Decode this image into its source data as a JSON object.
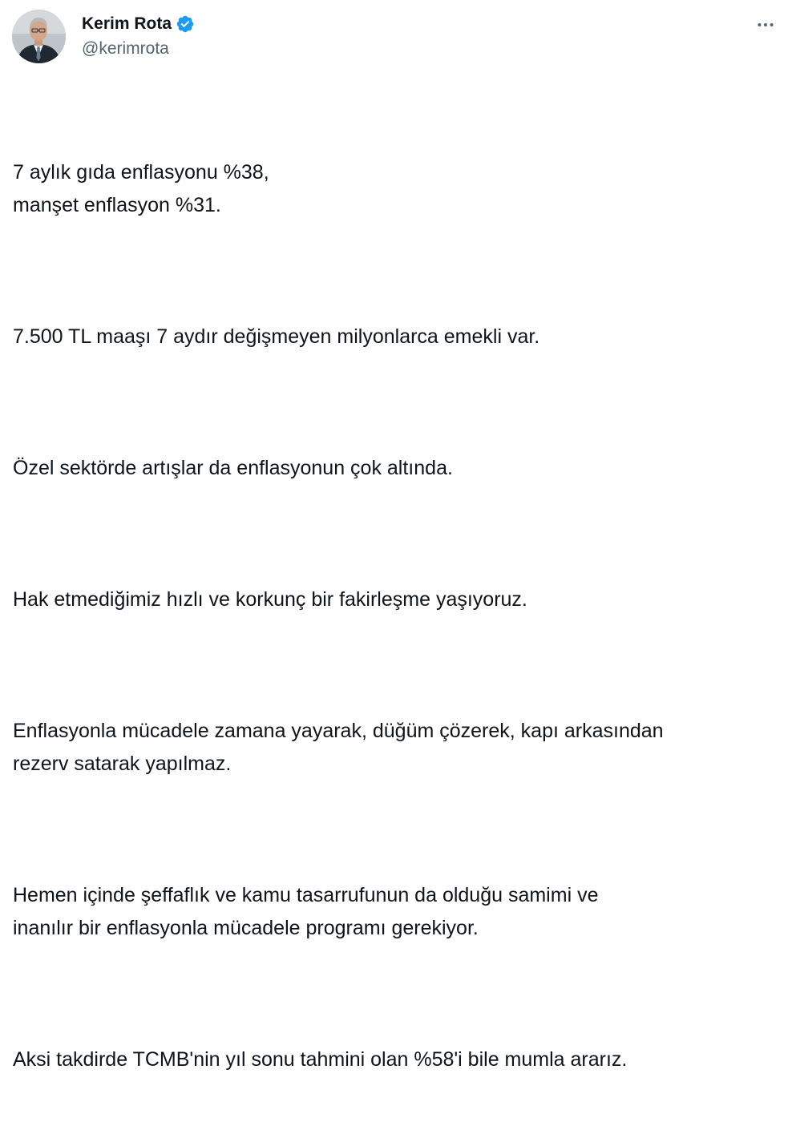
{
  "author": {
    "display_name": "Kerim Rota",
    "handle": "@kerimrota",
    "verified": true,
    "verified_color": "#1d9bf0"
  },
  "menu": {
    "icon": "more-horizontal-icon"
  },
  "tweet": {
    "paragraphs": [
      "7 aylık gıda enflasyonu %38,\nmanşet enflasyon %31.",
      "7.500 TL maaşı 7 aydır değişmeyen milyonlarca emekli var.",
      "Özel sektörde artışlar da enflasyonun çok altında.",
      "Hak etmediğimiz hızlı ve korkunç bir fakirleşme yaşıyoruz.",
      "Enflasyonla mücadele zamana yayarak, düğüm çözerek, kapı arkasından\nrezerv satarak yapılmaz.",
      "Hemen içinde şeffaflık ve kamu tasarrufunun da olduğu samimi ve\ninanılır bir enflasyonla mücadele programı gerekiyor.",
      "Aksi takdirde TCMB'nin yıl sonu tahmini olan %58'i bile mumla ararız."
    ]
  }
}
